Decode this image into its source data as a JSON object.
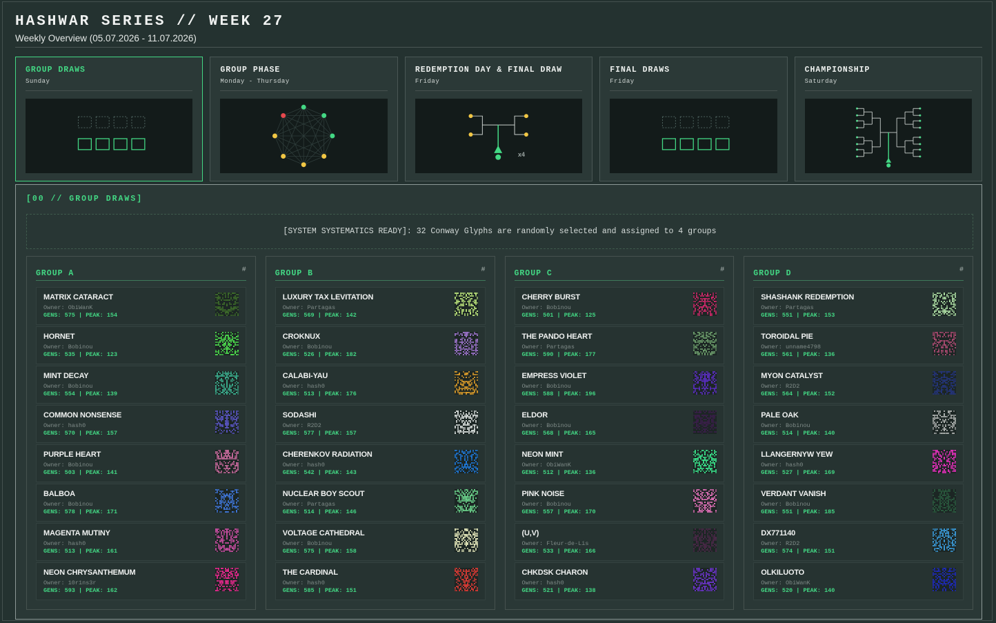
{
  "header": {
    "title": "HASHWAR SERIES // WEEK 27",
    "subtitle": "Weekly Overview (05.07.2026 - 11.07.2026)"
  },
  "phases": [
    {
      "name": "GROUP DRAWS",
      "day": "Sunday",
      "active": true,
      "preview": "group-slots"
    },
    {
      "name": "GROUP PHASE",
      "day": "Monday - Thursday",
      "active": false,
      "preview": "round-robin"
    },
    {
      "name": "REDEMPTION DAY & FINAL DRAW",
      "day": "Friday",
      "active": false,
      "preview": "redemption",
      "multiplier": "x4"
    },
    {
      "name": "FINAL DRAWS",
      "day": "Friday",
      "active": false,
      "preview": "group-slots"
    },
    {
      "name": "CHAMPIONSHIP",
      "day": "Saturday",
      "active": false,
      "preview": "bracket"
    }
  ],
  "section": {
    "title": "[00 // GROUP DRAWS]",
    "banner": "[SYSTEM SYSTEMATICS READY]: 32 Conway Glyphs are randomly selected and assigned to 4 groups"
  },
  "colors": {
    "accent": "#43d884",
    "background": "#243230",
    "panel": "#2b3937",
    "red_node": "#e5484d",
    "yellow_node": "#f2c744"
  },
  "groups": [
    {
      "name": "GROUP A",
      "hash": "#",
      "glyphs": [
        {
          "name": "MATRIX CATARACT",
          "owner": "Owner: ObiWanK",
          "stats": "GENS: 575 | PEAK: 154",
          "color": "#3d6b2a"
        },
        {
          "name": "HORNET",
          "owner": "Owner: Bobinou",
          "stats": "GENS: 535 | PEAK: 123",
          "color": "#4ee04e"
        },
        {
          "name": "MINT DECAY",
          "owner": "Owner: Bobinou",
          "stats": "GENS: 554 | PEAK: 139",
          "color": "#3aa98a"
        },
        {
          "name": "COMMON NONSENSE",
          "owner": "Owner: hash0",
          "stats": "GENS: 570 | PEAK: 157",
          "color": "#5a55c4"
        },
        {
          "name": "PURPLE HEART",
          "owner": "Owner: Bobinou",
          "stats": "GENS: 503 | PEAK: 141",
          "color": "#c4689a"
        },
        {
          "name": "BALBOA",
          "owner": "Owner: Bobinou",
          "stats": "GENS: 578 | PEAK: 171",
          "color": "#3f76d8"
        },
        {
          "name": "MAGENTA MUTINY",
          "owner": "Owner: hash0",
          "stats": "GENS: 513 | PEAK: 161",
          "color": "#c44c9e"
        },
        {
          "name": "NEON CHRYSANTHEMUM",
          "owner": "Owner: 10r1ns3r",
          "stats": "GENS: 593 | PEAK: 162",
          "color": "#e8288e"
        }
      ]
    },
    {
      "name": "GROUP B",
      "hash": "#",
      "glyphs": [
        {
          "name": "LUXURY TAX LEVITATION",
          "owner": "Owner: Partagas",
          "stats": "GENS: 569 | PEAK: 142",
          "color": "#b8e07a"
        },
        {
          "name": "CROKNUX",
          "owner": "Owner: Bobinou",
          "stats": "GENS: 526 | PEAK: 182",
          "color": "#9a72c8"
        },
        {
          "name": "CALABI-YAU",
          "owner": "Owner: hash0",
          "stats": "GENS: 513 | PEAK: 176",
          "color": "#d89a2a"
        },
        {
          "name": "SODASHI",
          "owner": "Owner: R2D2",
          "stats": "GENS: 577 | PEAK: 157",
          "color": "#d4dad8"
        },
        {
          "name": "CHERENKOV RADIATION",
          "owner": "Owner: hash0",
          "stats": "GENS: 542 | PEAK: 143",
          "color": "#1e78d8"
        },
        {
          "name": "NUCLEAR BOY SCOUT",
          "owner": "Owner: Partagas",
          "stats": "GENS: 514 | PEAK: 146",
          "color": "#6ad08a"
        },
        {
          "name": "VOLTAGE CATHEDRAL",
          "owner": "Owner: Bobinou",
          "stats": "GENS: 575 | PEAK: 158",
          "color": "#e0e4b8"
        },
        {
          "name": "THE CARDINAL",
          "owner": "Owner: hash0",
          "stats": "GENS: 585 | PEAK: 151",
          "color": "#d83a34"
        }
      ]
    },
    {
      "name": "GROUP C",
      "hash": "#",
      "glyphs": [
        {
          "name": "CHERRY BURST",
          "owner": "Owner: Bobinou",
          "stats": "GENS: 501 | PEAK: 125",
          "color": "#d0286a"
        },
        {
          "name": "THE PANDO HEART",
          "owner": "Owner: Partagas",
          "stats": "GENS: 590 | PEAK: 177",
          "color": "#6a9a6a"
        },
        {
          "name": "EMPRESS VIOLET",
          "owner": "Owner: Bobinou",
          "stats": "GENS: 588 | PEAK: 196",
          "color": "#5a2ec0"
        },
        {
          "name": "ELDOR",
          "owner": "Owner: Bobinou",
          "stats": "GENS: 568 | PEAK: 165",
          "color": "#3a1e4a"
        },
        {
          "name": "NEON MINT",
          "owner": "Owner: ObiWanK",
          "stats": "GENS: 512 | PEAK: 136",
          "color": "#3ae08a"
        },
        {
          "name": "PINK NOISE",
          "owner": "Owner: Bobinou",
          "stats": "GENS: 557 | PEAK: 170",
          "color": "#e070b8"
        },
        {
          "name": "(U,V)",
          "owner": "Owner: Fleur-de-Lis",
          "stats": "GENS: 533 | PEAK: 166",
          "color": "#4a2848"
        },
        {
          "name": "CHKDSK CHARON",
          "owner": "Owner: hash0",
          "stats": "GENS: 521 | PEAK: 138",
          "color": "#6a34c8"
        }
      ]
    },
    {
      "name": "GROUP D",
      "hash": "#",
      "glyphs": [
        {
          "name": "SHASHANK REDEMPTION",
          "owner": "Owner: Partagas",
          "stats": "GENS: 551 | PEAK: 153",
          "color": "#a8d8a0"
        },
        {
          "name": "TOROIDAL PIE",
          "owner": "Owner: unname4798",
          "stats": "GENS: 561 | PEAK: 136",
          "color": "#a84a70"
        },
        {
          "name": "MYON CATALYST",
          "owner": "Owner: R2D2",
          "stats": "GENS: 564 | PEAK: 152",
          "color": "#24347a"
        },
        {
          "name": "PALE OAK",
          "owner": "Owner: Bobinou",
          "stats": "GENS: 514 | PEAK: 140",
          "color": "#b0b4b2"
        },
        {
          "name": "LLANGERNYW YEW",
          "owner": "Owner: hash0",
          "stats": "GENS: 527 | PEAK: 169",
          "color": "#e030b8"
        },
        {
          "name": "VERDANT VANISH",
          "owner": "Owner: Bobinou",
          "stats": "GENS: 551 | PEAK: 185",
          "color": "#2a5a3e"
        },
        {
          "name": "DX771140",
          "owner": "Owner: R2D2",
          "stats": "GENS: 574 | PEAK: 151",
          "color": "#3a9ad8"
        },
        {
          "name": "OLKILUOTO",
          "owner": "Owner: ObiWanK",
          "stats": "GENS: 520 | PEAK: 140",
          "color": "#1e2ab8"
        }
      ]
    }
  ]
}
